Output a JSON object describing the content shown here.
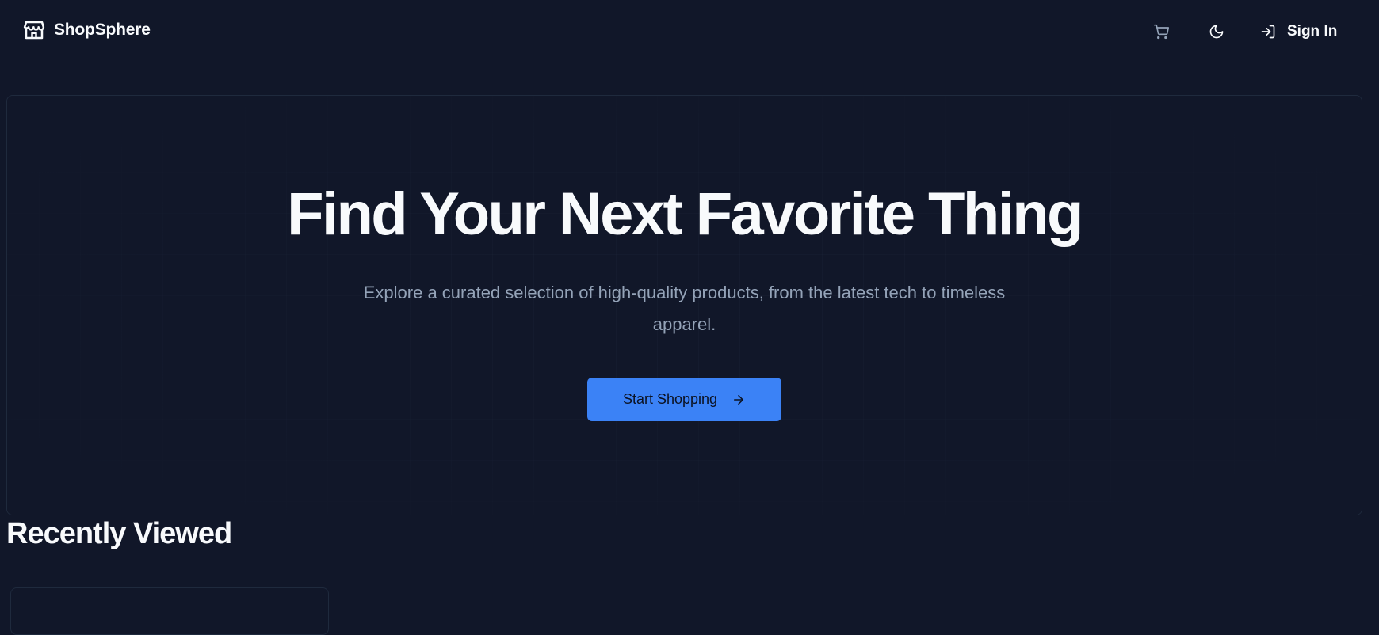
{
  "header": {
    "brand": {
      "name": "ShopSphere",
      "icon": "store-icon"
    },
    "cart": {
      "icon": "cart-icon"
    },
    "theme_toggle": {
      "icon": "moon-icon"
    },
    "sign_in": {
      "label": "Sign In",
      "icon": "sign-in-icon"
    }
  },
  "hero": {
    "title": "Find Your Next Favorite Thing",
    "subtitle": "Explore a curated selection of high-quality products, from the latest tech to timeless apparel.",
    "cta": {
      "label": "Start Shopping",
      "icon": "arrow-right-icon"
    }
  },
  "recent": {
    "title": "Recently Viewed"
  },
  "colors": {
    "background": "#111729",
    "accent": "#3b82f6",
    "text": "#f8fafc",
    "muted": "#94a3b8",
    "border": "#1f2a3d"
  }
}
